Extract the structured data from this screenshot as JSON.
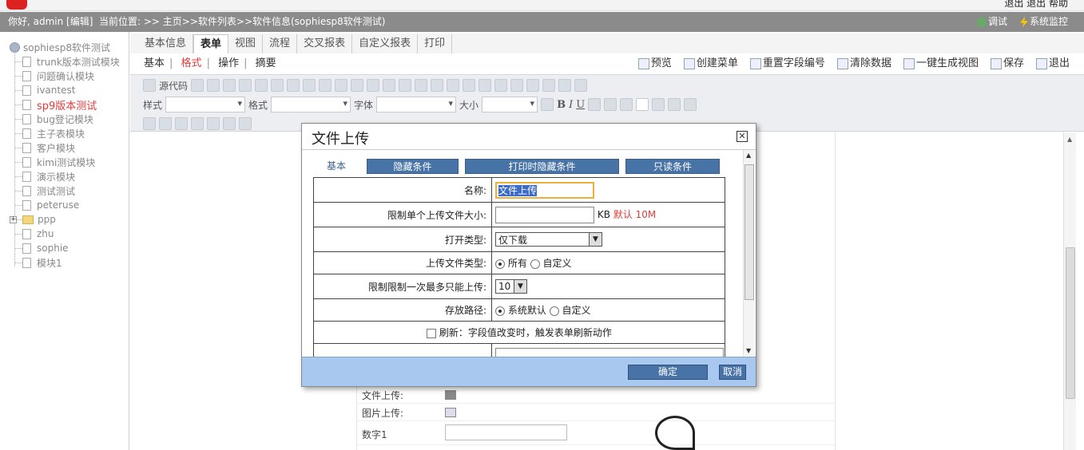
{
  "top": {
    "right_text": "退出 退出 帮助"
  },
  "status": {
    "greeting": "你好, admin [编辑]",
    "breadcrumb": "当前位置: >> 主页>>软件列表>>软件信息(sophiesp8软件测试)",
    "tools": [
      "调试",
      "系统监控"
    ]
  },
  "tree": {
    "root": "sophiesp8软件测试",
    "items": [
      {
        "label": "trunk版本测试模块",
        "type": "doc"
      },
      {
        "label": "问题确认模块",
        "type": "doc"
      },
      {
        "label": "ivantest",
        "type": "doc"
      },
      {
        "label": "sp9版本测试",
        "type": "doc",
        "active": true
      },
      {
        "label": "bug登记模块",
        "type": "doc"
      },
      {
        "label": "主子表模块",
        "type": "doc"
      },
      {
        "label": "客户模块",
        "type": "doc"
      },
      {
        "label": "kimi测试模块",
        "type": "doc"
      },
      {
        "label": "演示模块",
        "type": "doc"
      },
      {
        "label": "测试测试",
        "type": "doc"
      },
      {
        "label": "peteruse",
        "type": "doc"
      },
      {
        "label": "ppp",
        "type": "folder"
      },
      {
        "label": "zhu",
        "type": "doc"
      },
      {
        "label": "sophie",
        "type": "doc"
      },
      {
        "label": "模块1",
        "type": "doc"
      }
    ]
  },
  "tabs": [
    "基本信息",
    "表单",
    "视图",
    "流程",
    "交叉报表",
    "自定义报表",
    "打印"
  ],
  "active_tab": "表单",
  "subtabs": [
    "基本",
    "格式",
    "操作",
    "摘要"
  ],
  "active_subtab": "格式",
  "actions": [
    "预览",
    "创建菜单",
    "重置字段编号",
    "清除数据",
    "一键生成视图",
    "保存",
    "退出"
  ],
  "toolbar": {
    "source": "源代码",
    "style_label": "样式",
    "format_label": "格式",
    "font_label": "字体",
    "size_label": "大小"
  },
  "page_rows": [
    {
      "label": "文件上传:",
      "kind": "icon"
    },
    {
      "label": "图片上传:",
      "kind": "image"
    },
    {
      "label": "数字1",
      "kind": "input"
    }
  ],
  "modal": {
    "title": "文件上传",
    "tabs": [
      "基本",
      "隐藏条件",
      "打印时隐藏条件",
      "只读条件"
    ],
    "name_label": "名称:",
    "name_value": "文件上传",
    "size_label": "限制单个上传文件大小:",
    "size_unit": "KB",
    "size_default": "默认 10M",
    "open_label": "打开类型:",
    "open_value": "仅下载",
    "type_label": "上传文件类型:",
    "type_all": "所有",
    "type_custom": "自定义",
    "limit_label": "限制限制一次最多只能上传:",
    "limit_value": "10",
    "path_label": "存放路径:",
    "path_default": "系统默认",
    "path_custom": "自定义",
    "refresh_text": "刷新：字段值改变时，触发表单刷新动作",
    "ok": "确定",
    "cancel": "取消"
  },
  "colors": {
    "status_bg": "#8b8b8b",
    "modal_footer": "#a9c8ef",
    "tab_blue": "#4873a6",
    "accent_red": "#e03c3c"
  }
}
